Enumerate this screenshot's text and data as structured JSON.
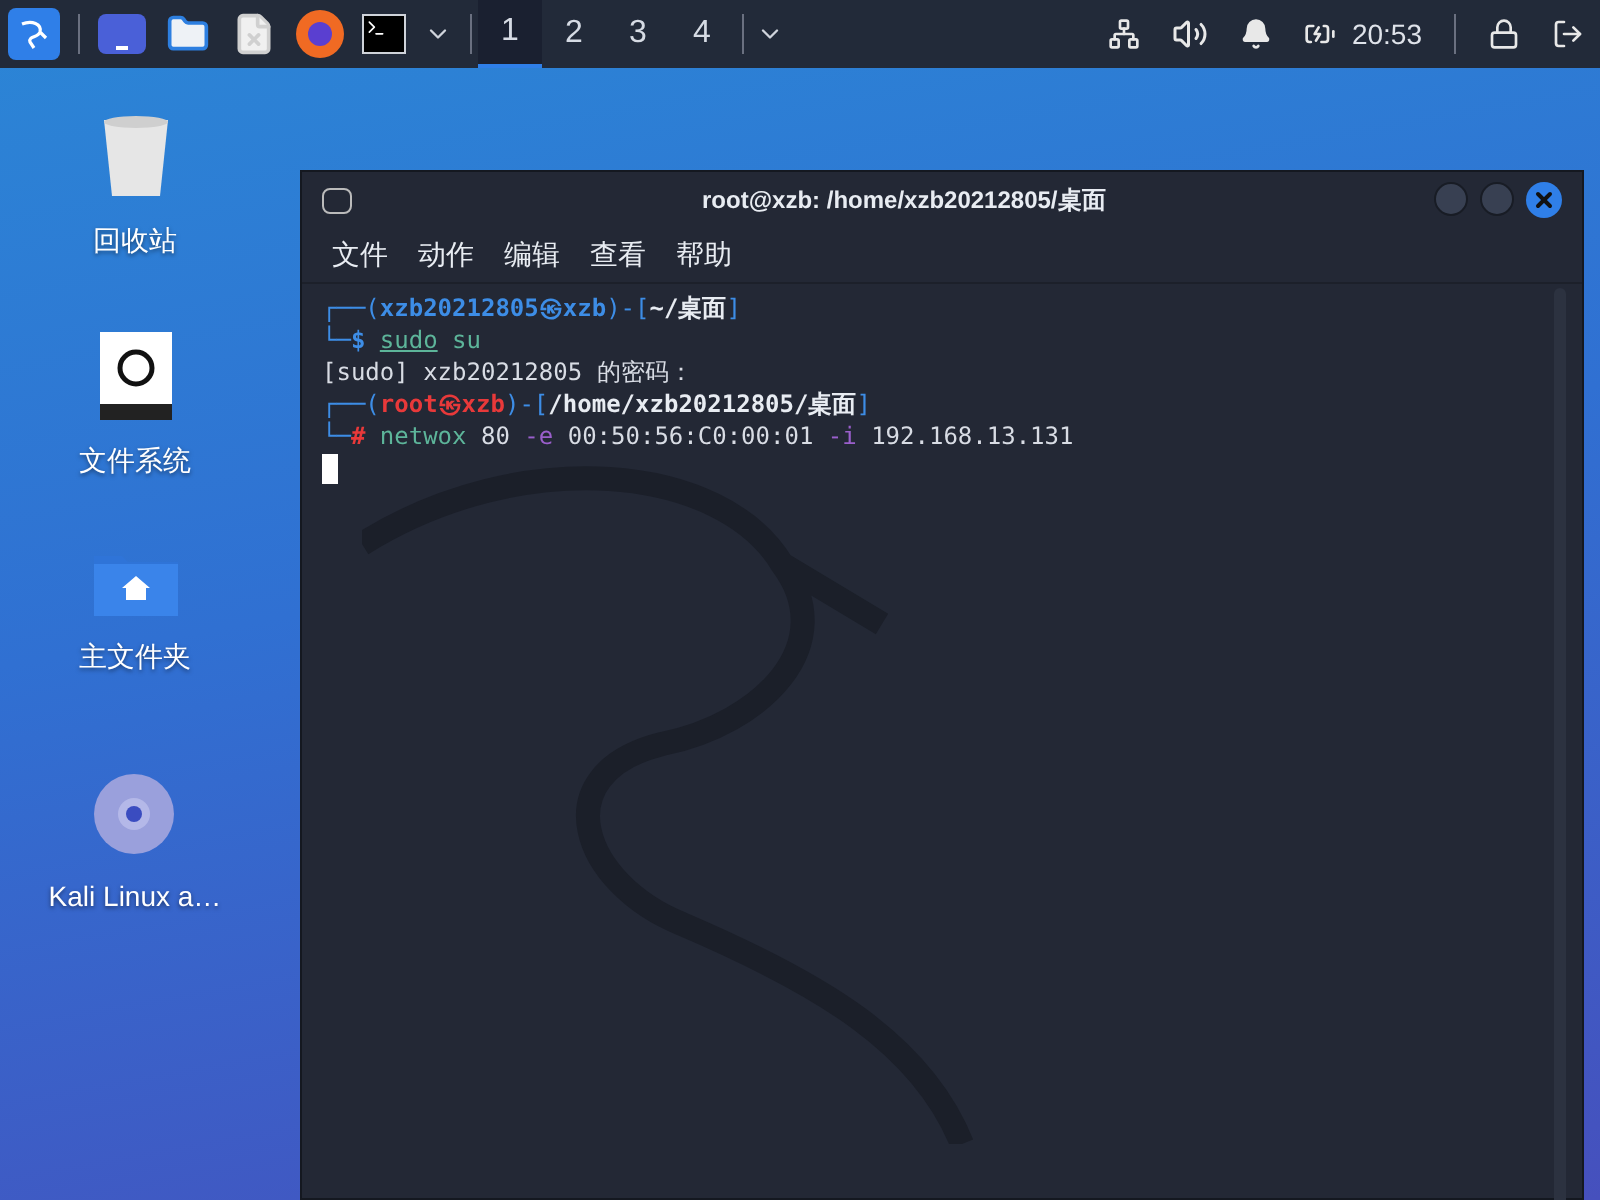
{
  "taskbar": {
    "launchers": [
      {
        "kind": "kali"
      },
      {
        "kind": "desktop"
      },
      {
        "kind": "files"
      },
      {
        "kind": "editor"
      },
      {
        "kind": "browser"
      },
      {
        "kind": "terminal"
      }
    ],
    "workspaces": [
      {
        "label": "1",
        "selected": true
      },
      {
        "label": "2",
        "selected": false
      },
      {
        "label": "3",
        "selected": false
      },
      {
        "label": "4",
        "selected": false
      }
    ],
    "clock": "20:53"
  },
  "desktop_icons": [
    {
      "kind": "trash",
      "label": "回收站"
    },
    {
      "kind": "drive",
      "label": "文件系统"
    },
    {
      "kind": "home",
      "label": "主文件夹"
    },
    {
      "kind": "disc",
      "label": "Kali Linux a…"
    }
  ],
  "terminal": {
    "title": "root@xzb: /home/xzb20212805/桌面",
    "menu": [
      "文件",
      "动作",
      "编辑",
      "查看",
      "帮助"
    ],
    "lines": [
      [
        {
          "text": "┌──(",
          "kind": "frame"
        },
        {
          "text": "xzb20212805㉿xzb",
          "kind": "user"
        },
        {
          "text": ")-[",
          "kind": "frame"
        },
        {
          "text": "~/桌面",
          "kind": "path"
        },
        {
          "text": "]",
          "kind": "frame"
        }
      ],
      [
        {
          "text": "└─",
          "kind": "frame"
        },
        {
          "text": "$ ",
          "kind": "dollar"
        },
        {
          "text": "sudo",
          "kind": "exec"
        },
        {
          "text": " su",
          "kind": "command"
        }
      ],
      [
        {
          "text": "[sudo] xzb20212805 的密码：",
          "kind": "text"
        }
      ],
      [
        {
          "text": "┌──(",
          "kind": "frame"
        },
        {
          "text": "root㉿xzb",
          "kind": "root"
        },
        {
          "text": ")-[",
          "kind": "frame"
        },
        {
          "text": "/home/xzb20212805/桌面",
          "kind": "path"
        },
        {
          "text": "]",
          "kind": "frame"
        }
      ],
      [
        {
          "text": "└─",
          "kind": "frame"
        },
        {
          "text": "#",
          "kind": "hash"
        },
        {
          "text": " netwox",
          "kind": "command"
        },
        {
          "text": " 80 ",
          "kind": "text"
        },
        {
          "text": "-e",
          "kind": "option"
        },
        {
          "text": " 00:50:56:C0:00:01 ",
          "kind": "text"
        },
        {
          "text": "-i",
          "kind": "option"
        },
        {
          "text": " 192.168.13.131",
          "kind": "text"
        }
      ]
    ]
  }
}
